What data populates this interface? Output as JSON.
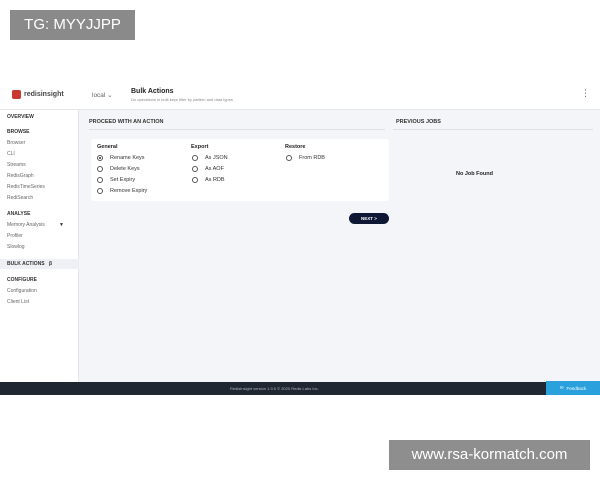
{
  "watermark": {
    "top": "TG: MYYJJPP",
    "bottom": "www.rsa-kormatch.com"
  },
  "header": {
    "logo_text": "redisinsight",
    "db_select": "local",
    "title": "Bulk Actions",
    "subtitle": "Do operations in bulk keys filter by pattern and data types"
  },
  "sidebar": {
    "overview": "OVERVIEW",
    "browse": "BROWSE",
    "browse_items": [
      "Browser",
      "CLI",
      "Streams",
      "RedisGraph",
      "RedisTimeSeries",
      "RediSearch"
    ],
    "analyse": "ANALYSE",
    "analyse_items": [
      "Memory Analysis",
      "Profiler",
      "Slowlog"
    ],
    "bulk_actions": "BULK ACTIONS",
    "configure": "CONFIGURE",
    "configure_items": [
      "Configuration",
      "Client List"
    ]
  },
  "main": {
    "heading": "PROCEED WITH AN ACTION",
    "general_title": "General",
    "general_options": [
      "Rename Keys",
      "Delete Keys",
      "Set Expiry",
      "Remove Expiry"
    ],
    "general_selected": "Rename Keys",
    "export_title": "Export",
    "export_options": [
      "As JSON",
      "As AOF",
      "As RDB"
    ],
    "restore_title": "Restore",
    "restore_options": [
      "From RDB"
    ],
    "next_label": "NEXT >"
  },
  "previous": {
    "heading": "PREVIOUS JOBS",
    "empty": "No Job Found"
  },
  "footer": {
    "text": "RedisInsight version 1.9.0 © 2020 Redis Labs Inc.",
    "feedback": "Feedback"
  },
  "colors": {
    "accent": "#c9382f",
    "dark": "#0e1734",
    "feedback": "#2aa1dd",
    "footer": "#1f2733"
  }
}
